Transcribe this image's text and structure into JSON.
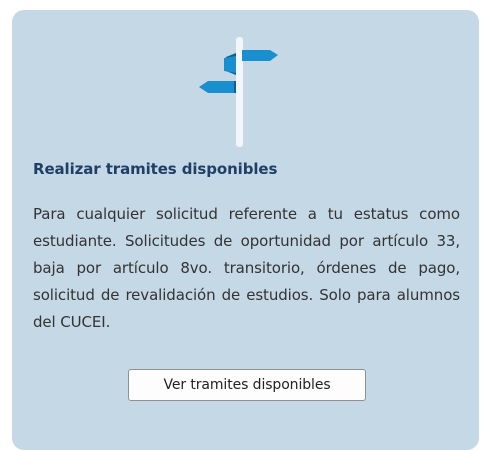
{
  "card": {
    "icon": "signpost-icon",
    "title": "Realizar tramites disponibles",
    "description": "Para cualquier solicitud referente a tu estatus como estudiante. Solicitudes de oportunidad por artículo 33, baja por artículo 8vo. transitorio, órdenes de pago, solicitud de revalidación de estudios. Solo para alumnos del CUCEI.",
    "button_label": "Ver tramites disponibles"
  },
  "colors": {
    "card_background": "#c5d8e5",
    "title": "#1f3f66",
    "sign_blue": "#1a8fd0",
    "post": "#f3f6f8"
  }
}
